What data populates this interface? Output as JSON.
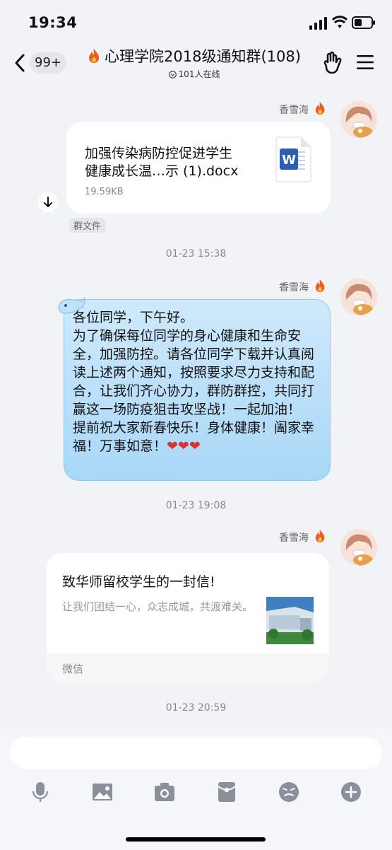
{
  "status_bar": {
    "time": "19:34"
  },
  "header": {
    "unread_badge": "99+",
    "title": "心理学院2018级通知群(108)",
    "online": "101人在线"
  },
  "messages": {
    "file_msg": {
      "sender": "香雪海",
      "file_name_line1": "加强传染病防控促进学生",
      "file_name_line2": "健康成长温…示 (1).docx",
      "file_size": "19.59KB",
      "tag": "群文件",
      "timestamp": "01-23 15:38"
    },
    "text_msg": {
      "sender": "香雪海",
      "text": "各位同学，下午好。\n为了确保每位同学的身心健康和生命安全，加强防控。请各位同学下载并认真阅读上述两个通知，按照要求尽力支持和配合，让我们齐心协力，群防群控，共同打赢这一场防疫狙击攻坚战！一起加油！\n提前祝大家新春快乐！身体健康！阖家幸福！万事如意！",
      "hearts": "❤❤❤",
      "timestamp": "01-23 19:08"
    },
    "share_msg": {
      "sender": "香雪海",
      "title": "致华师留校学生的一封信!",
      "desc": "让我们团结一心，众志成城，共渡难关。",
      "source": "微信",
      "timestamp": "01-23 20:59"
    }
  },
  "colors": {
    "bubble": "#a9d7f7",
    "badge": "#e4e6ec",
    "fire": "#f25a1e"
  },
  "icons": [
    "back-icon",
    "fire-icon",
    "hand-icon",
    "menu-icon",
    "download-icon",
    "word-icon",
    "mic-icon",
    "image-icon",
    "camera-icon",
    "red-packet-icon",
    "emoji-icon",
    "plus-icon"
  ]
}
